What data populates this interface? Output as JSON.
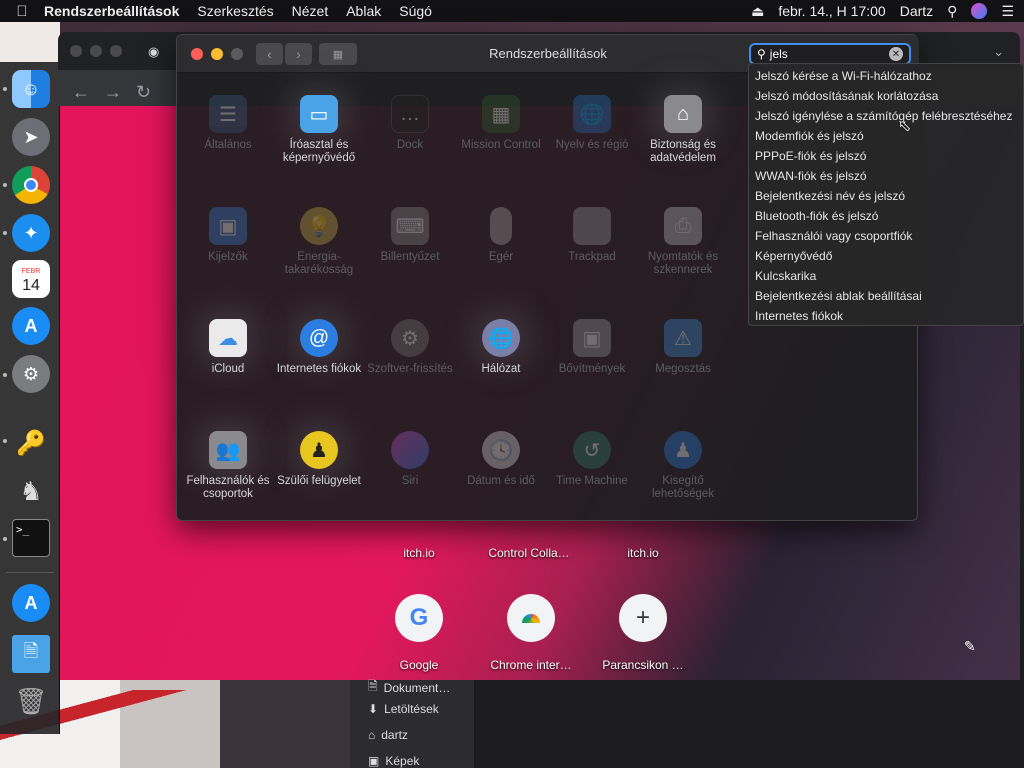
{
  "menubar": {
    "app_name": "Rendszerbeállítások",
    "menus": [
      "Szerkesztés",
      "Nézet",
      "Ablak",
      "Súgó"
    ],
    "datetime": "febr. 14., H 17:00",
    "user": "Dartz"
  },
  "dock": {
    "calendar_month": "FEBR",
    "calendar_day": "14"
  },
  "browser": {
    "tiles_top": [
      "itch.io",
      "Control Colla…",
      "itch.io"
    ],
    "tiles_bottom": [
      "Google",
      "Chrome inter…",
      "Parancsikon …"
    ]
  },
  "finder_sidebar": [
    "Dokument…",
    "Letöltések",
    "dartz",
    "Képek"
  ],
  "prefs": {
    "title": "Rendszerbeállítások",
    "search_value": "jels",
    "panes": [
      [
        "Általános",
        "Íróasztal és képernyővédő",
        "Dock",
        "Mission Control",
        "Nyelv és régió",
        "Biztonság és adatvédelem"
      ],
      [
        "Kijelzők",
        "Energia-takarékosság",
        "Billentyűzet",
        "Egér",
        "Trackpad",
        "Nyomtatók és szkennerek"
      ],
      [
        "iCloud",
        "Internetes fiókok",
        "Szoftver-frissítés",
        "Hálózat",
        "Bővítmények",
        "Megosztás"
      ],
      [
        "Felhasználók és csoportok",
        "Szülői felügyelet",
        "Siri",
        "Dátum és idő",
        "Time Machine",
        "Kisegítő lehetőségek"
      ]
    ]
  },
  "search_results": [
    "Jelszó kérése a Wi-Fi-hálózathoz",
    "Jelszó módosításának korlátozása",
    "Jelszó igénylése a számítógép felébresztéséhez",
    "Modemfiók és jelszó",
    "PPPoE-fiók és jelszó",
    "WWAN-fiók és jelszó",
    "Bejelentkezési név és jelszó",
    "Bluetooth-fiók és jelszó",
    "Felhasználói vagy csoportfiók",
    "Képernyővédő",
    "Kulcskarika",
    "Bejelentkezési ablak beállításai",
    "Internetes fiókok"
  ]
}
